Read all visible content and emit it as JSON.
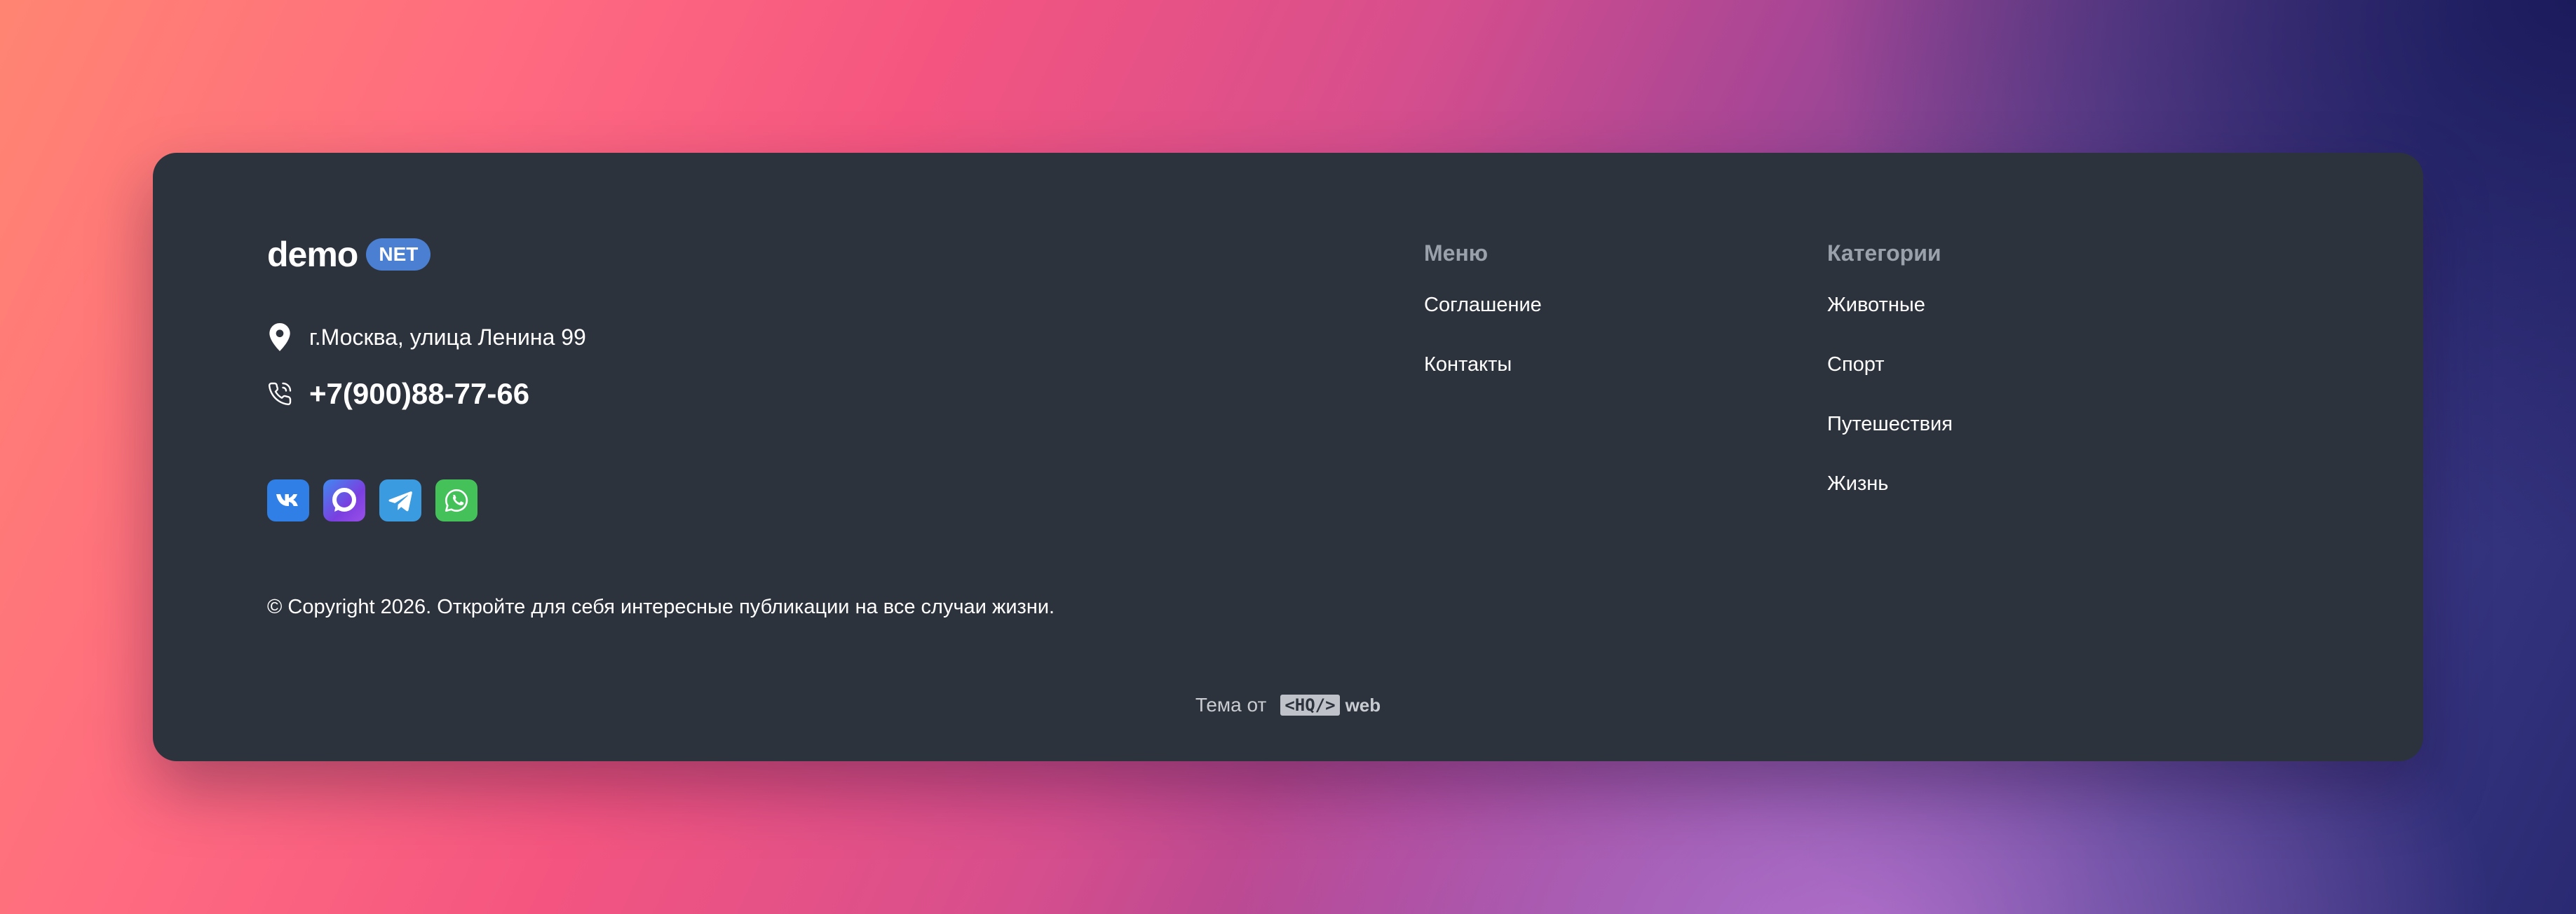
{
  "brand": {
    "name": "demo",
    "badge": "NET"
  },
  "contacts": {
    "address": "г.Москва, улица Ленина 99",
    "phone": "+7(900)88-77-66"
  },
  "socials": [
    {
      "name": "VK",
      "icon": "vk-icon",
      "color": "#2f7fe6"
    },
    {
      "name": "Max",
      "icon": "max-messenger-icon",
      "color": "#6b3fe0"
    },
    {
      "name": "Telegram",
      "icon": "telegram-icon",
      "color": "#3a9be0"
    },
    {
      "name": "WhatsApp",
      "icon": "whatsapp-icon",
      "color": "#45c15a"
    }
  ],
  "copyright": "© Copyright 2026. Откройте для себя интересные публикации на все случаи жизни.",
  "menu": {
    "title": "Меню",
    "items": [
      "Соглашение",
      "Контакты"
    ]
  },
  "categories": {
    "title": "Категории",
    "items": [
      "Животные",
      "Спорт",
      "Путешествия",
      "Жизнь"
    ]
  },
  "theme_credit": {
    "label": "Тема от",
    "logo_box": "<HQ/>",
    "logo_suffix": "web"
  },
  "colors": {
    "card_bg": "#2d333d",
    "badge": "#4a7fd1",
    "muted_heading": "#9aa1ab"
  }
}
